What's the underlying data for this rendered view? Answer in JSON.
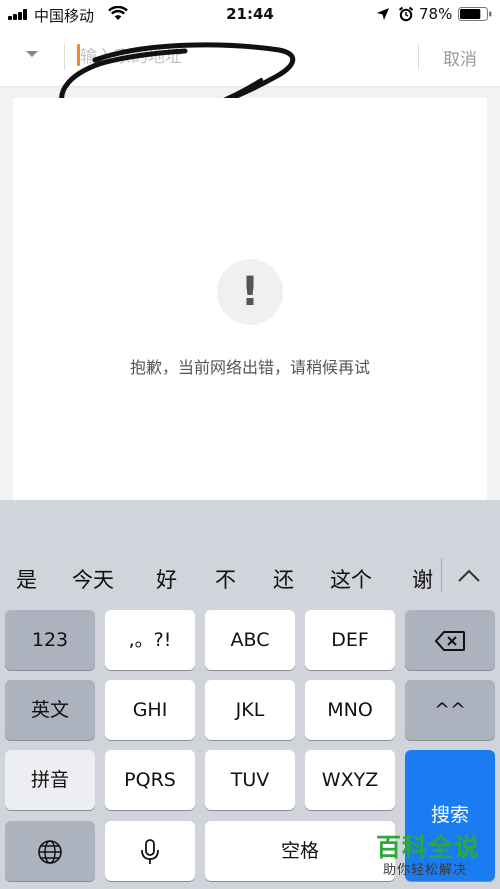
{
  "status_bar": {
    "carrier": "中国移动",
    "time": "21:44",
    "battery_percent": "78%",
    "battery_level": 0.78,
    "icons": [
      "signal-icon",
      "wifi-icon",
      "location-icon",
      "alarm-icon",
      "battery-icon"
    ]
  },
  "header": {
    "search_placeholder": "输入家的地址",
    "cancel_label": "取消"
  },
  "content": {
    "error_icon": "!",
    "error_message": "抱歉，当前网络出错，请稍候再试"
  },
  "keyboard": {
    "candidates": [
      "是",
      "今天",
      "好",
      "不",
      "还",
      "这个",
      "谢"
    ],
    "rows": [
      [
        "123",
        ",。?!",
        "ABC",
        "DEF",
        "delete"
      ],
      [
        "英文",
        "GHI",
        "JKL",
        "MNO",
        "^^"
      ],
      [
        "拼音",
        "PQRS",
        "TUV",
        "WXYZ",
        "搜索"
      ],
      [
        "globe",
        "microphone",
        "空格"
      ]
    ],
    "colors": {
      "accent": "#1a7cf3",
      "caret": "#f08a24"
    }
  },
  "watermark": {
    "title": "百科全说",
    "subtitle": "助你轻松解决"
  }
}
